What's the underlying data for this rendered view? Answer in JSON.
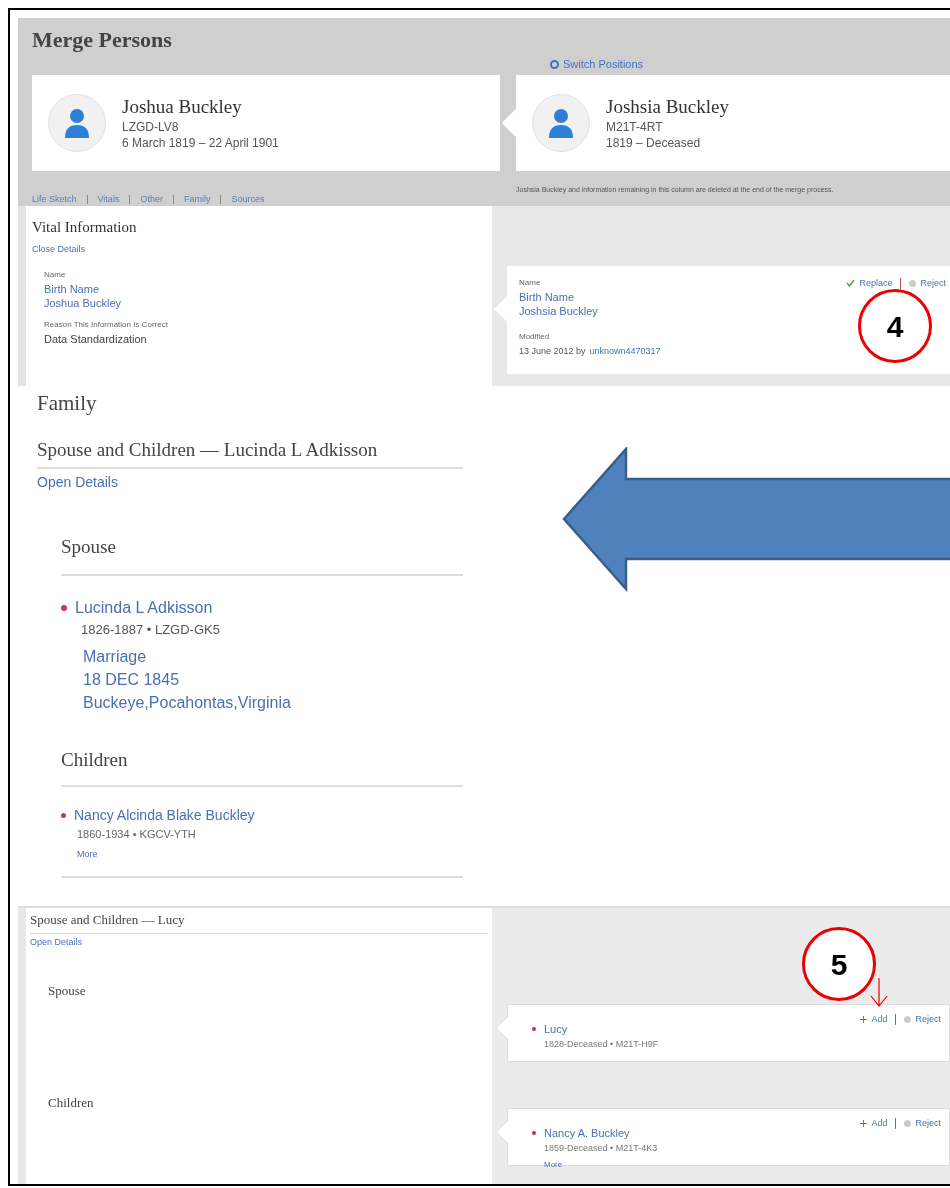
{
  "title": "Merge Persons",
  "switch_positions": "Switch Positions",
  "persons": [
    {
      "name": "Joshua Buckley",
      "id": "LZGD-LV8",
      "dates": "6 March 1819 – 22 April 1901"
    },
    {
      "name": "Joshsia Buckley",
      "id": "M21T-4RT",
      "dates": "1819 – Deceased"
    }
  ],
  "section_links": [
    "Life Sketch",
    "Vitals",
    "Other",
    "Family",
    "Sources"
  ],
  "deletion_note": "Joshsia Buckley and information remaining in this column are deleted at the end of the merge process.",
  "vital_information": {
    "heading": "Vital Information",
    "toggle": "Close Details",
    "left": {
      "label": "Name",
      "type": "Birth Name",
      "value": "Joshua Buckley",
      "reason_label": "Reason This Information Is Correct",
      "reason": "Data Standardization"
    },
    "right": {
      "label": "Name",
      "type": "Birth Name",
      "value": "Joshsia Buckley",
      "modified_label": "Modified",
      "modified": "13 June 2012 by",
      "modified_by": "unknown4470317",
      "actions": [
        {
          "kind": "replace",
          "label": "Replace"
        },
        {
          "kind": "reject",
          "label": "Reject"
        }
      ]
    }
  },
  "family": {
    "heading": "Family",
    "group_heading": "Spouse and Children — Lucinda L Adkisson",
    "toggle": "Open Details",
    "spouse_heading": "Spouse",
    "spouse": {
      "name": "Lucinda L Adkisson",
      "info": "1826-1887 • LZGD-GK5",
      "event": "Marriage",
      "date": "18 DEC 1845",
      "place": "Buckeye,Pocahontas,Virginia"
    },
    "children_heading": "Children",
    "children": [
      {
        "name": "Nancy Alcinda Blake Buckley",
        "info": "1860-1934 • KGCV-YTH",
        "more": "More"
      }
    ]
  },
  "second_family": {
    "group_heading": "Spouse and Children — Lucy",
    "toggle": "Open Details",
    "spouse_heading": "Spouse",
    "children_heading": "Children",
    "spouse": {
      "name": "Lucy",
      "info": "1828-Deceased • M21T-H9F",
      "actions": [
        {
          "kind": "add",
          "label": "Add"
        },
        {
          "kind": "reject",
          "label": "Reject"
        }
      ]
    },
    "children": [
      {
        "name": "Nancy A. Buckley",
        "info": "1859-Deceased • M21T-4K3",
        "more": "More",
        "actions": [
          {
            "kind": "add",
            "label": "Add"
          },
          {
            "kind": "reject",
            "label": "Reject"
          }
        ]
      }
    ]
  },
  "callouts": [
    "4",
    "5"
  ]
}
